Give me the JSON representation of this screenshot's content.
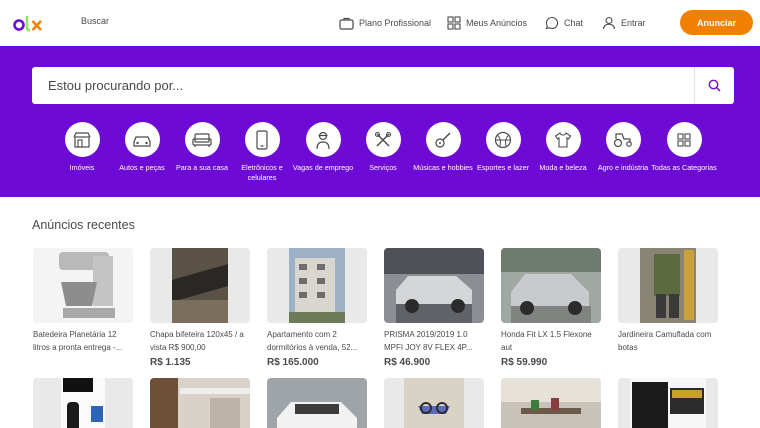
{
  "header": {
    "search_link": "Buscar",
    "nav": [
      {
        "label": "Plano Profissional",
        "icon": "briefcase-icon"
      },
      {
        "label": "Meus Anúncios",
        "icon": "grid-icon"
      },
      {
        "label": "Chat",
        "icon": "chat-icon"
      },
      {
        "label": "Entrar",
        "icon": "user-icon"
      }
    ],
    "cta_label": "Anunciar",
    "colors": {
      "brand_purple": "#6e0ad6",
      "accent_orange": "#f28000",
      "logo_green": "#8ce563"
    }
  },
  "search": {
    "placeholder": "Estou procurando por...",
    "icon": "search-icon"
  },
  "categories": [
    {
      "label": "Imóveis",
      "icon": "store-icon"
    },
    {
      "label": "Autos e peças",
      "icon": "car-icon"
    },
    {
      "label": "Para a sua casa",
      "icon": "sofa-icon"
    },
    {
      "label": "Eletrônicos e celulares",
      "icon": "phone-icon"
    },
    {
      "label": "Vagas de emprego",
      "icon": "worker-icon"
    },
    {
      "label": "Serviços",
      "icon": "tools-icon"
    },
    {
      "label": "Músicas e hobbies",
      "icon": "guitar-icon"
    },
    {
      "label": "Esportes e lazer",
      "icon": "ball-icon"
    },
    {
      "label": "Moda e beleza",
      "icon": "shirt-icon"
    },
    {
      "label": "Agro e indústria",
      "icon": "tractor-icon"
    },
    {
      "label": "Todas as Categorias",
      "icon": "apps-icon"
    }
  ],
  "recent": {
    "title": "Anúncios recentes",
    "items": [
      {
        "title": "Batedeira Planetária 12 litros a pronta entrega -...",
        "price": ""
      },
      {
        "title": "Chapa bifeteira 120x45 / a vista R$ 900,00",
        "price": "R$ 1.135"
      },
      {
        "title": "Apartamento com 2 dormitórios à venda, 52...",
        "price": "R$ 165.000"
      },
      {
        "title": "PRISMA 2019/2019 1.0 MPFI JOY 8V FLEX 4P...",
        "price": "R$ 46.900"
      },
      {
        "title": "Honda Fit LX 1.5 Flexone aut",
        "price": "R$ 59.990"
      },
      {
        "title": "Jardineira Camuflada com botas",
        "price": ""
      }
    ]
  }
}
